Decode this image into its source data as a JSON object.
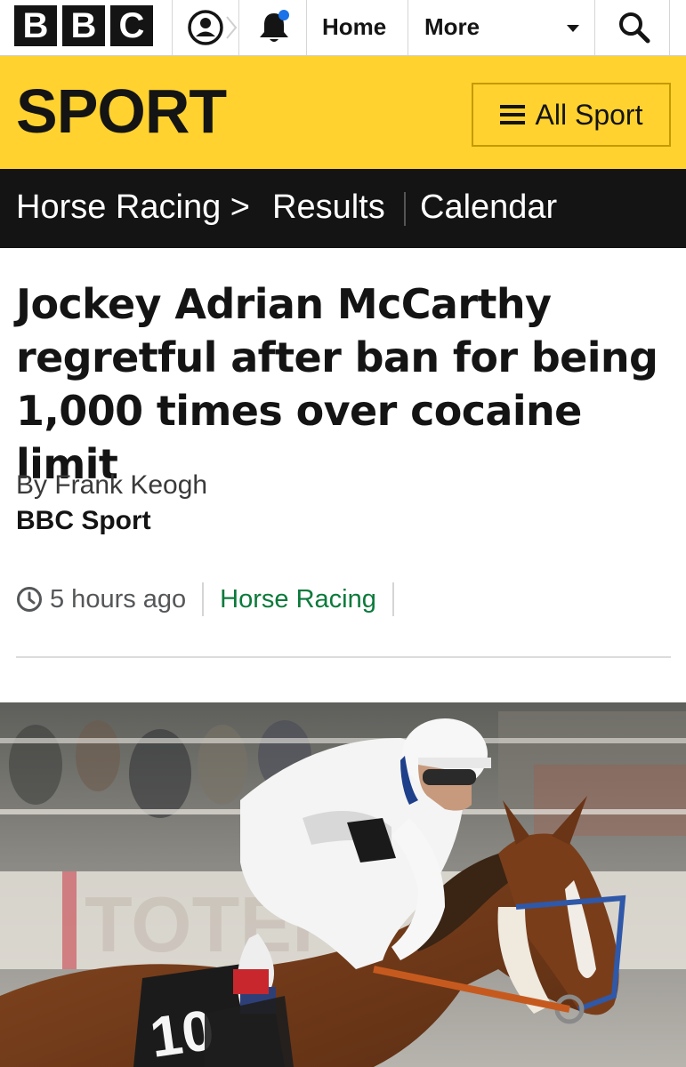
{
  "topbar": {
    "logo_letters": [
      "B",
      "B",
      "C"
    ],
    "account_icon": "account-icon",
    "notifications_icon": "bell-icon",
    "home_label": "Home",
    "more_label": "More",
    "search_icon": "search-icon"
  },
  "sport_header": {
    "title": "SPORT",
    "all_sport_label": "All Sport",
    "brand_color": "#ffd230"
  },
  "section_nav": {
    "current": "Horse Racing >",
    "items": [
      "Results",
      "Calendar"
    ]
  },
  "article": {
    "headline": "Jockey Adrian McCarthy regretful after ban for being 1,000 times over cocaine limit",
    "byline": "By Frank Keogh",
    "source": "BBC Sport",
    "timestamp": "5 hours ago",
    "section_link": "Horse Racing",
    "section_link_color": "#0b7a3b"
  },
  "photo": {
    "saddle_cloth_number": "10",
    "hoarding_text": "TOTEPO"
  }
}
